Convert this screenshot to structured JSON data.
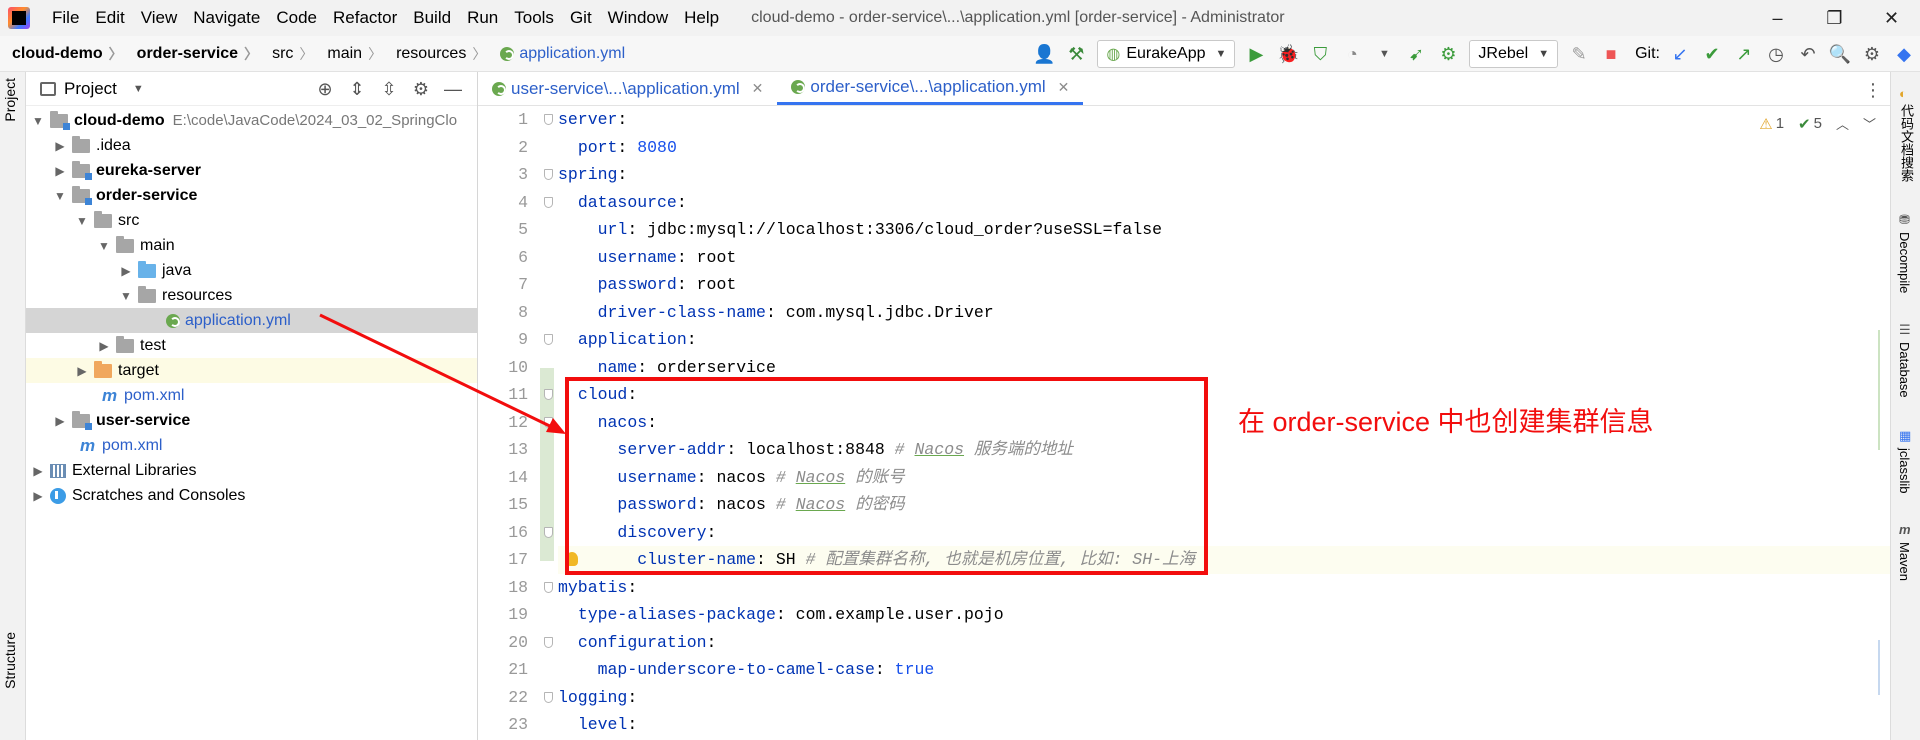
{
  "window": {
    "menu": [
      "File",
      "Edit",
      "View",
      "Navigate",
      "Code",
      "Refactor",
      "Build",
      "Run",
      "Tools",
      "Git",
      "Window",
      "Help"
    ],
    "title": "cloud-demo - order-service\\...\\application.yml [order-service] - Administrator",
    "controls": [
      "–",
      "❐",
      "✕"
    ]
  },
  "breadcrumbs": [
    "cloud-demo",
    "order-service",
    "src",
    "main",
    "resources",
    "application.yml"
  ],
  "toolbar": {
    "run_config": "EurakeApp",
    "jrebel": "JRebel",
    "git_label": "Git:"
  },
  "left_stripe": {
    "project_tab": "Project",
    "structure_tab": "Structure"
  },
  "project": {
    "title": "Project",
    "tree": [
      {
        "label": "cloud-demo",
        "path": "E:\\code\\JavaCode\\2024_03_02_SpringClo"
      },
      {
        "label": ".idea"
      },
      {
        "label": "eureka-server"
      },
      {
        "label": "order-service"
      },
      {
        "label": "src"
      },
      {
        "label": "main"
      },
      {
        "label": "java"
      },
      {
        "label": "resources"
      },
      {
        "label": "application.yml"
      },
      {
        "label": "test"
      },
      {
        "label": "target"
      },
      {
        "label": "pom.xml"
      },
      {
        "label": "user-service"
      },
      {
        "label": "pom.xml"
      },
      {
        "label": "External Libraries"
      },
      {
        "label": "Scratches and Consoles"
      }
    ]
  },
  "tabs": [
    {
      "label": "user-service\\...\\application.yml"
    },
    {
      "label": "order-service\\...\\application.yml"
    }
  ],
  "inspection": {
    "warnings": "1",
    "ok": "5"
  },
  "editor": {
    "lines": [
      {
        "no": "1",
        "key": "server",
        "sep": ":",
        "val": "",
        "comment": ""
      },
      {
        "no": "2",
        "key": "port",
        "sep": ": ",
        "val": "8080",
        "comment": ""
      },
      {
        "no": "3",
        "key": "spring",
        "sep": ":",
        "val": "",
        "comment": ""
      },
      {
        "no": "4",
        "key": "datasource",
        "sep": ":",
        "val": "",
        "comment": ""
      },
      {
        "no": "5",
        "key": "url",
        "sep": ": ",
        "val": "jdbc:mysql://localhost:3306/cloud_order?useSSL=false",
        "comment": ""
      },
      {
        "no": "6",
        "key": "username",
        "sep": ": ",
        "val": "root",
        "comment": ""
      },
      {
        "no": "7",
        "key": "password",
        "sep": ": ",
        "val": "root",
        "comment": ""
      },
      {
        "no": "8",
        "key": "driver-class-name",
        "sep": ": ",
        "val": "com.mysql.jdbc.Driver",
        "comment": ""
      },
      {
        "no": "9",
        "key": "application",
        "sep": ":",
        "val": "",
        "comment": ""
      },
      {
        "no": "10",
        "key": "name",
        "sep": ": ",
        "val": "orderservice",
        "comment": ""
      },
      {
        "no": "11",
        "key": "cloud",
        "sep": ":",
        "val": "",
        "comment": ""
      },
      {
        "no": "12",
        "key": "nacos",
        "sep": ":",
        "val": "",
        "comment": ""
      },
      {
        "no": "13",
        "key": "server-addr",
        "sep": ": ",
        "val": "localhost:8848",
        "comment_pre": " # ",
        "comment_em": "Nacos",
        "comment": " 服务端的地址"
      },
      {
        "no": "14",
        "key": "username",
        "sep": ": ",
        "val": "nacos",
        "comment_pre": " # ",
        "comment_em": "Nacos",
        "comment": " 的账号"
      },
      {
        "no": "15",
        "key": "password",
        "sep": ": ",
        "val": "nacos",
        "comment_pre": " # ",
        "comment_em": "Nacos",
        "comment": " 的密码"
      },
      {
        "no": "16",
        "key": "discovery",
        "sep": ":",
        "val": "",
        "comment": ""
      },
      {
        "no": "17",
        "key": "cluster-name",
        "sep": ": ",
        "val": "SH",
        "comment_pre": " # ",
        "comment_em": "",
        "comment": "配置集群名称, 也就是机房位置, 比如: SH-上海"
      },
      {
        "no": "18",
        "key": "mybatis",
        "sep": ":",
        "val": "",
        "comment": ""
      },
      {
        "no": "19",
        "key": "type-aliases-package",
        "sep": ": ",
        "val": "com.example.user.pojo",
        "comment": ""
      },
      {
        "no": "20",
        "key": "configuration",
        "sep": ":",
        "val": "",
        "comment": ""
      },
      {
        "no": "21",
        "key": "map-underscore-to-camel-case",
        "sep": ": ",
        "val": "true",
        "comment": ""
      },
      {
        "no": "22",
        "key": "logging",
        "sep": ":",
        "val": "",
        "comment": ""
      },
      {
        "no": "23",
        "key": "level",
        "sep": ":",
        "val": "",
        "comment": ""
      }
    ]
  },
  "right_stripe": [
    "代码文档搜索",
    "Decompile",
    "Database",
    "jclasslib",
    "Maven"
  ],
  "annotation": {
    "text": "在 order-service 中也创建集群信息",
    "color": "#f20d0d"
  }
}
